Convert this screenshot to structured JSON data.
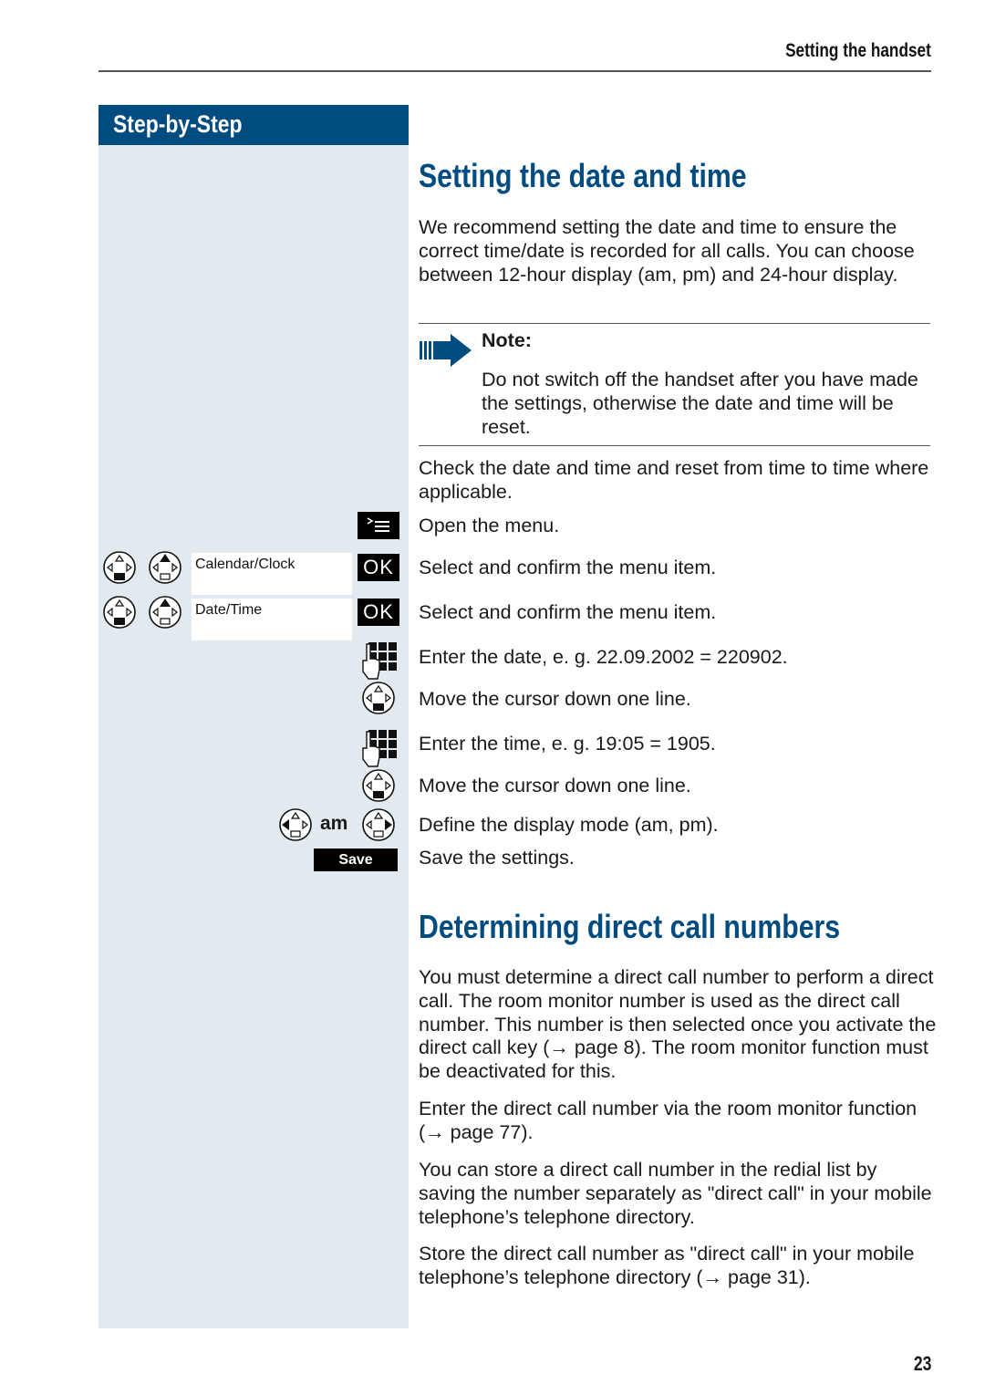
{
  "header": {
    "running_title": "Setting the handset"
  },
  "sidebar": {
    "title": "Step-by-Step"
  },
  "section1": {
    "title": "Setting the date and time",
    "intro": "We recommend setting the date and time to ensure the correct time/date is recorded for all calls. You can choose between 12-hour display (am, pm) and 24-hour display.",
    "note": {
      "icon": "note-arrow-icon",
      "title": "Note:",
      "text": "Do not switch off the handset after you have made the settings, otherwise the date and time will be reset."
    },
    "check_text": "Check the date and time and reset from time to time where applicable.",
    "steps": [
      {
        "icons": [
          "menu-key-icon"
        ],
        "text": "Open the menu."
      },
      {
        "icons": [
          "nav-down-icon",
          "nav-up-icon",
          "ok-key-icon"
        ],
        "menu_item": "Calendar/Clock",
        "key_label": "OK",
        "text": "Select and confirm the menu item."
      },
      {
        "icons": [
          "nav-down-icon",
          "nav-up-icon",
          "ok-key-icon"
        ],
        "menu_item": "Date/Time",
        "key_label": "OK",
        "text": "Select and confirm the menu item."
      },
      {
        "icons": [
          "keypad-icon"
        ],
        "text": "Enter the date, e. g. 22.09.2002 = 220902."
      },
      {
        "icons": [
          "nav-down-icon"
        ],
        "text": "Move the cursor down one line."
      },
      {
        "icons": [
          "keypad-icon"
        ],
        "text": "Enter the time, e. g. 19:05 = 1905."
      },
      {
        "icons": [
          "nav-down-icon"
        ],
        "text": "Move the cursor down one line."
      },
      {
        "icons": [
          "nav-left-icon",
          "nav-right-icon"
        ],
        "value_label": "am",
        "text": "Define the display mode (am, pm)."
      },
      {
        "icons": [
          "save-key-icon"
        ],
        "key_label": "Save",
        "text": "Save the settings."
      }
    ]
  },
  "section2": {
    "title": "Determining direct call numbers",
    "paragraphs": [
      "You must determine a direct call number to perform a direct call. The room monitor number is used as the direct call number. This number is then selected once you activate the direct call key (→ page 8). The room monitor function must be deactivated for this.",
      "Enter the direct call number via the room monitor function (→ page 77).",
      "You can store a direct call number in the redial list by saving the number separately as \"direct call\" in your mobile telephone’s telephone directory.",
      "Store the direct call number as \"direct call\" in your mobile telephone’s telephone directory (→ page 31)."
    ]
  },
  "footer": {
    "page_number": "23"
  },
  "colors": {
    "brand_blue": "#004b80",
    "sidebar_bg": "#e2eaf0"
  }
}
